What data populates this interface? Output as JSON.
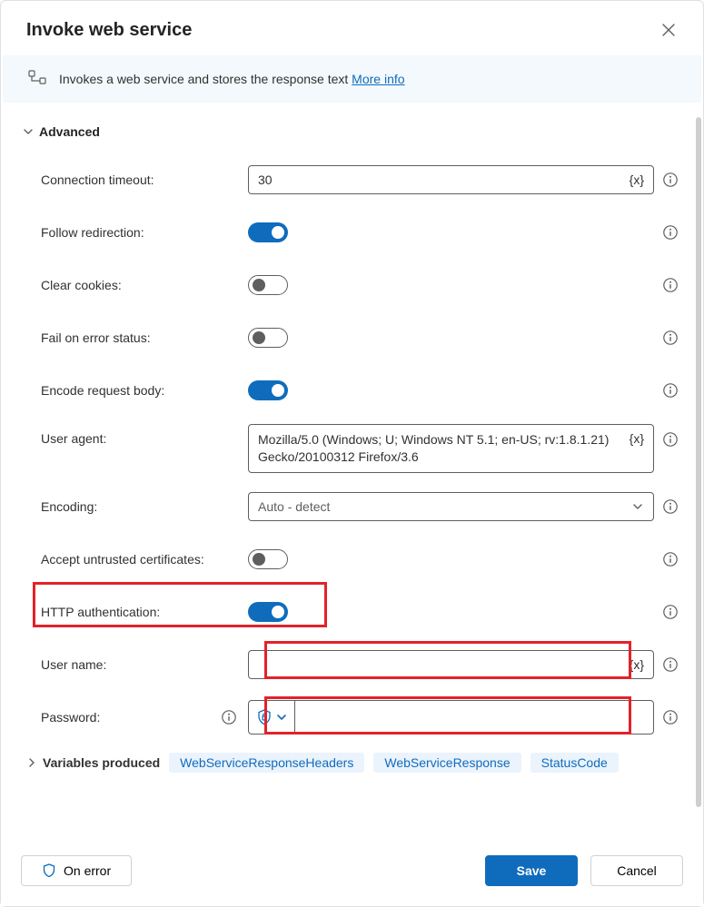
{
  "dialog": {
    "title": "Invoke web service",
    "banner_text": "Invokes a web service and stores the response text ",
    "banner_link": "More info"
  },
  "sections": {
    "advanced": {
      "label": "Advanced",
      "fields": {
        "connection_timeout": {
          "label": "Connection timeout:",
          "value": "30"
        },
        "follow_redirection": {
          "label": "Follow redirection:",
          "on": true
        },
        "clear_cookies": {
          "label": "Clear cookies:",
          "on": false
        },
        "fail_on_error_status": {
          "label": "Fail on error status:",
          "on": false
        },
        "encode_request_body": {
          "label": "Encode request body:",
          "on": true
        },
        "user_agent": {
          "label": "User agent:",
          "value": "Mozilla/5.0 (Windows; U; Windows NT 5.1; en-US; rv:1.8.1.21) Gecko/20100312 Firefox/3.6"
        },
        "encoding": {
          "label": "Encoding:",
          "value": "Auto - detect"
        },
        "accept_untrusted": {
          "label": "Accept untrusted certificates:",
          "on": false
        },
        "http_auth": {
          "label": "HTTP authentication:",
          "on": true
        },
        "user_name": {
          "label": "User name:",
          "value": ""
        },
        "password": {
          "label": "Password:",
          "value": ""
        }
      }
    },
    "variables": {
      "label": "Variables produced",
      "chips": [
        "WebServiceResponseHeaders",
        "WebServiceResponse",
        "StatusCode"
      ]
    }
  },
  "tokens": {
    "var_token": "{x}"
  },
  "footer": {
    "on_error": "On error",
    "save": "Save",
    "cancel": "Cancel"
  }
}
